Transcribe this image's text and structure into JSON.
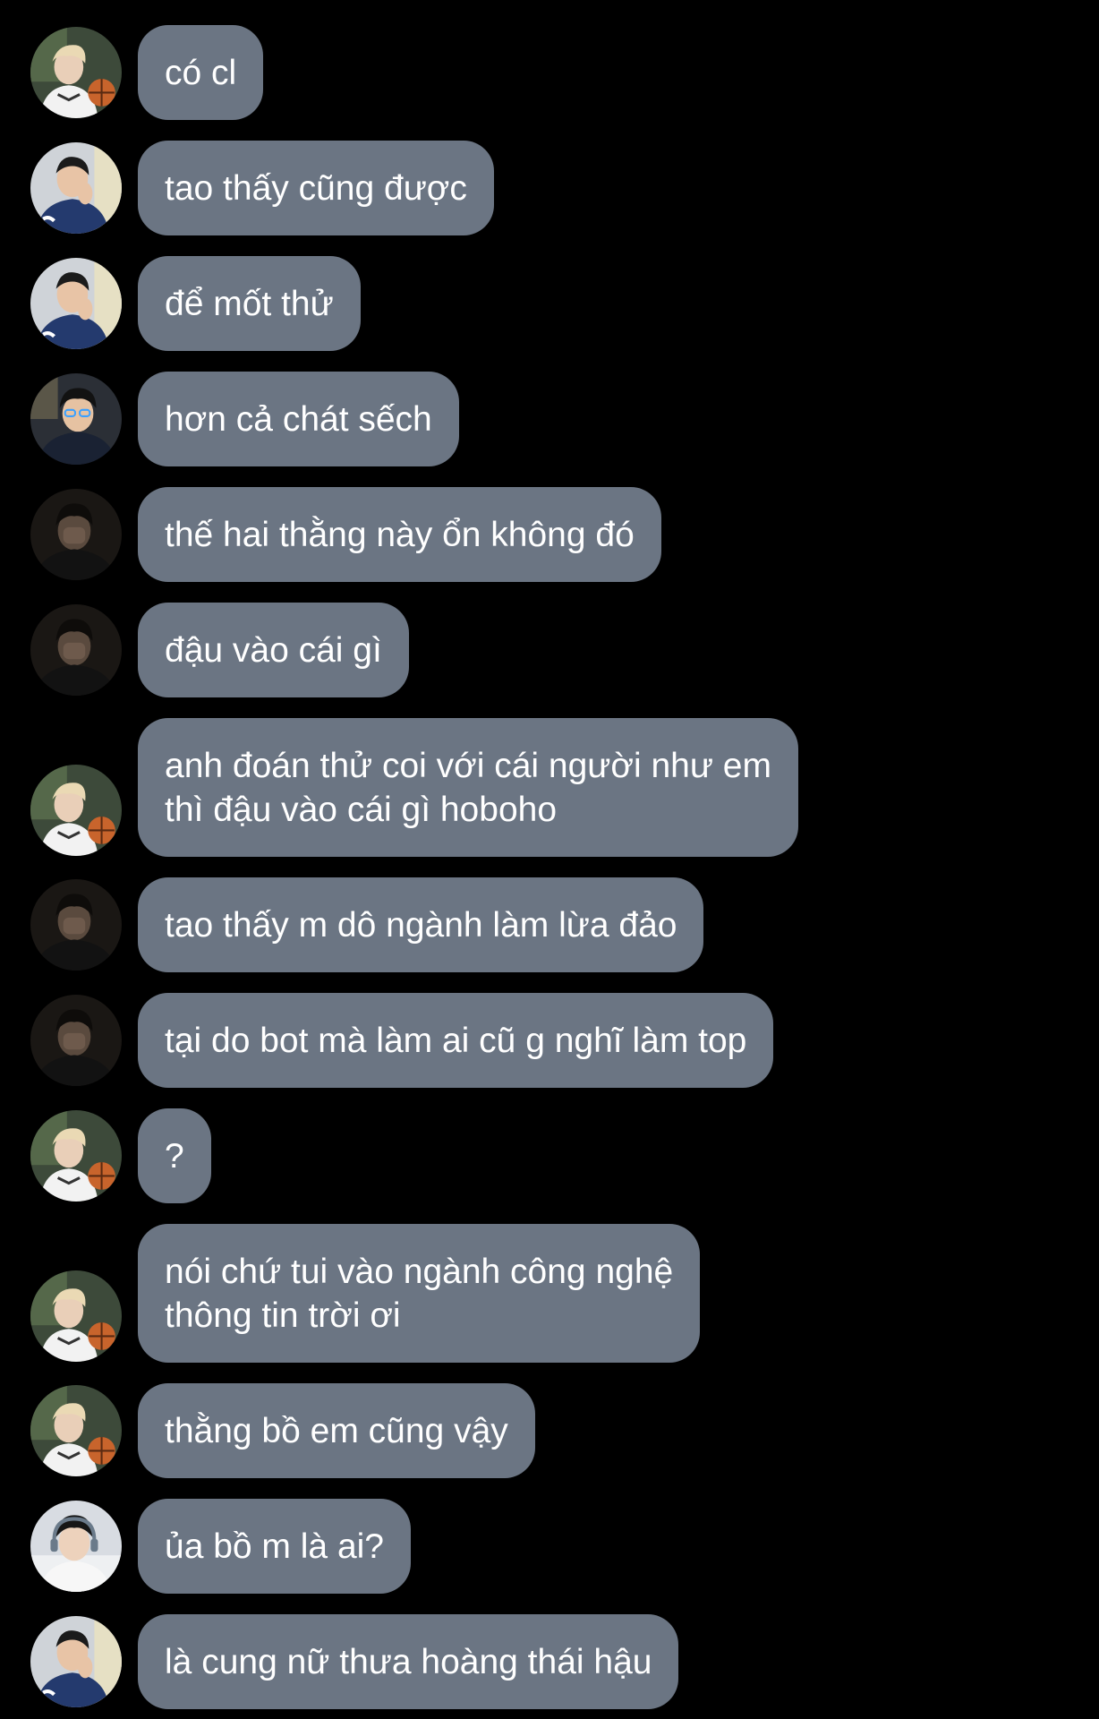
{
  "colors": {
    "background": "#000000",
    "bubble": "#6b7583",
    "text": "#ffffff"
  },
  "messages": [
    {
      "text": "có cl",
      "avatar": "blond-basketball-avatar"
    },
    {
      "text": "tao thấy cũng được",
      "avatar": "peace-sign-jacket-avatar"
    },
    {
      "text": "để mốt thử",
      "avatar": "peace-sign-jacket-avatar"
    },
    {
      "text": "hơn cả chát sếch",
      "avatar": "glasses-boy-avatar"
    },
    {
      "text": "thế hai thằng này ổn không đó",
      "avatar": "face-cover-dark-avatar"
    },
    {
      "text": "đậu vào cái gì",
      "avatar": "face-cover-dark-avatar"
    },
    {
      "text": "anh đoán thử coi với cái người như em\nthì đậu vào cái gì hoboho",
      "avatar": "blond-basketball-avatar"
    },
    {
      "text": "tao thấy m dô ngành làm lừa đảo",
      "avatar": "face-cover-dark-avatar"
    },
    {
      "text": "tại do bot mà làm ai cũ g nghĩ làm top",
      "avatar": "face-cover-dark-avatar"
    },
    {
      "text": "?",
      "avatar": "blond-basketball-avatar"
    },
    {
      "text": "nói chứ tui vào ngành công nghệ\nthông tin trời ơi",
      "avatar": "blond-basketball-avatar"
    },
    {
      "text": "thằng bồ em cũng vậy",
      "avatar": "blond-basketball-avatar"
    },
    {
      "text": "ủa bồ m là ai?",
      "avatar": "headset-boy-avatar"
    },
    {
      "text": "là cung nữ thưa hoàng thái hậu",
      "avatar": "peace-sign-jacket-avatar"
    }
  ]
}
